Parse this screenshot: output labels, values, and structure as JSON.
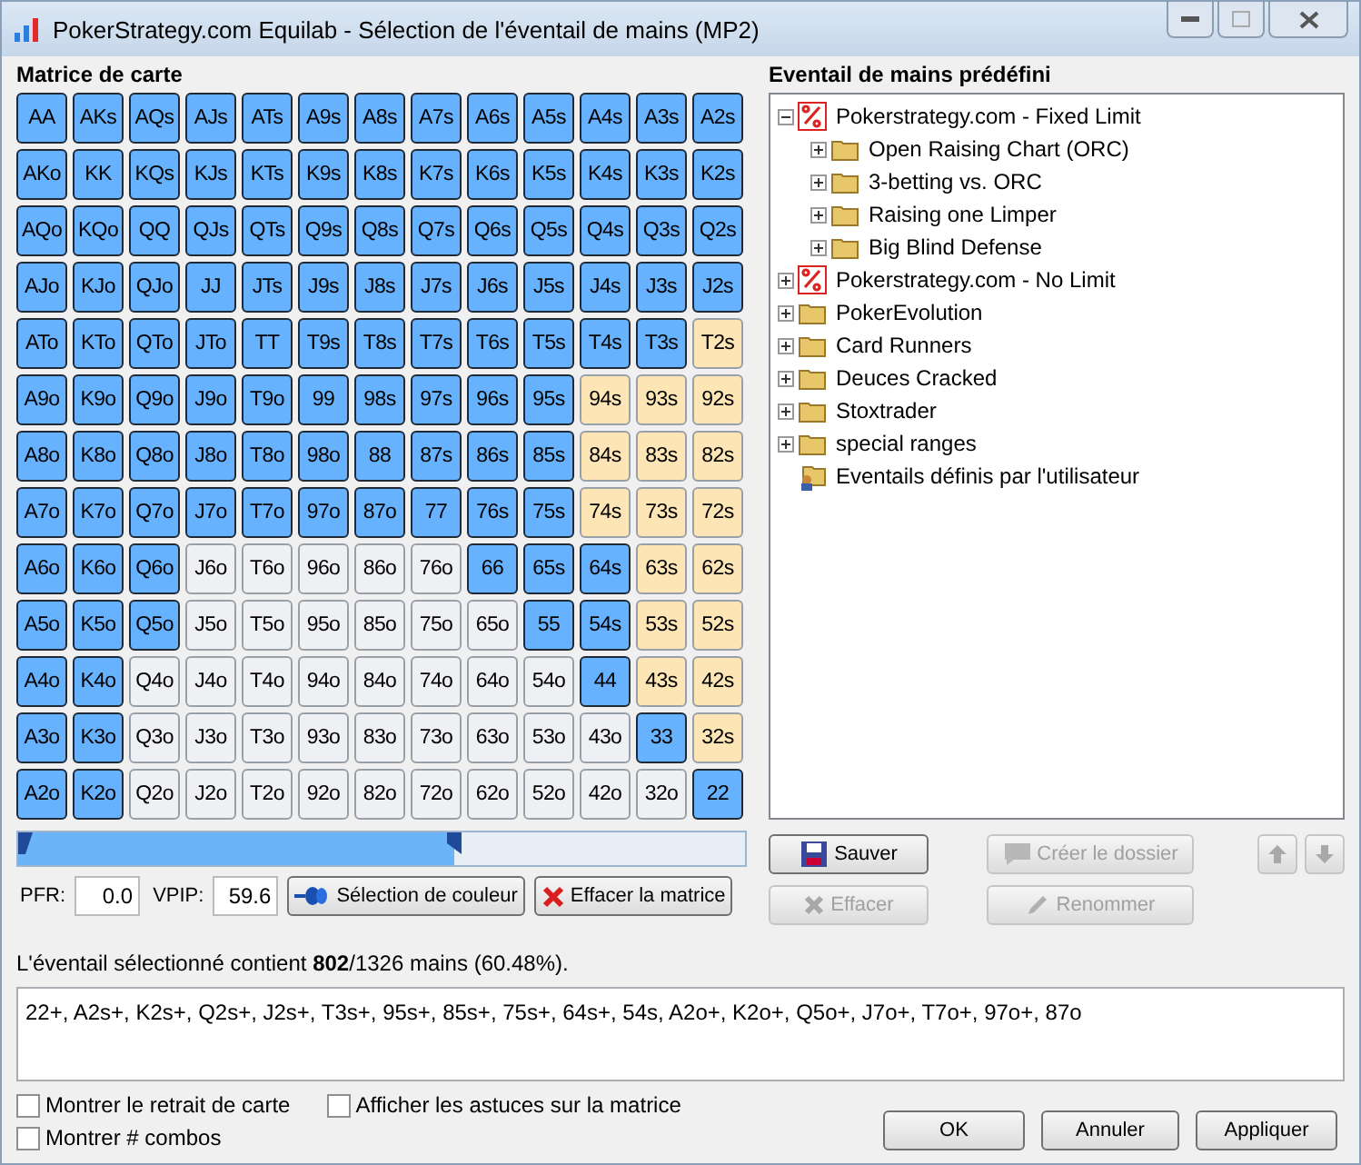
{
  "window": {
    "title": "PokerStrategy.com Equilab - Sélection de l'éventail de mains (MP2)"
  },
  "matrix": {
    "title": "Matrice de carte",
    "rows": [
      [
        {
          "label": "AA",
          "kind": "pair",
          "selected": true
        },
        {
          "label": "AKs",
          "kind": "suited",
          "selected": true
        },
        {
          "label": "AQs",
          "kind": "suited",
          "selected": true
        },
        {
          "label": "AJs",
          "kind": "suited",
          "selected": true
        },
        {
          "label": "ATs",
          "kind": "suited",
          "selected": true
        },
        {
          "label": "A9s",
          "kind": "suited",
          "selected": true
        },
        {
          "label": "A8s",
          "kind": "suited",
          "selected": true
        },
        {
          "label": "A7s",
          "kind": "suited",
          "selected": true
        },
        {
          "label": "A6s",
          "kind": "suited",
          "selected": true
        },
        {
          "label": "A5s",
          "kind": "suited",
          "selected": true
        },
        {
          "label": "A4s",
          "kind": "suited",
          "selected": true
        },
        {
          "label": "A3s",
          "kind": "suited",
          "selected": true
        },
        {
          "label": "A2s",
          "kind": "suited",
          "selected": true
        }
      ],
      [
        {
          "label": "AKo",
          "kind": "offsuit",
          "selected": true
        },
        {
          "label": "KK",
          "kind": "pair",
          "selected": true
        },
        {
          "label": "KQs",
          "kind": "suited",
          "selected": true
        },
        {
          "label": "KJs",
          "kind": "suited",
          "selected": true
        },
        {
          "label": "KTs",
          "kind": "suited",
          "selected": true
        },
        {
          "label": "K9s",
          "kind": "suited",
          "selected": true
        },
        {
          "label": "K8s",
          "kind": "suited",
          "selected": true
        },
        {
          "label": "K7s",
          "kind": "suited",
          "selected": true
        },
        {
          "label": "K6s",
          "kind": "suited",
          "selected": true
        },
        {
          "label": "K5s",
          "kind": "suited",
          "selected": true
        },
        {
          "label": "K4s",
          "kind": "suited",
          "selected": true
        },
        {
          "label": "K3s",
          "kind": "suited",
          "selected": true
        },
        {
          "label": "K2s",
          "kind": "suited",
          "selected": true
        }
      ],
      [
        {
          "label": "AQo",
          "kind": "offsuit",
          "selected": true
        },
        {
          "label": "KQo",
          "kind": "offsuit",
          "selected": true
        },
        {
          "label": "QQ",
          "kind": "pair",
          "selected": true
        },
        {
          "label": "QJs",
          "kind": "suited",
          "selected": true
        },
        {
          "label": "QTs",
          "kind": "suited",
          "selected": true
        },
        {
          "label": "Q9s",
          "kind": "suited",
          "selected": true
        },
        {
          "label": "Q8s",
          "kind": "suited",
          "selected": true
        },
        {
          "label": "Q7s",
          "kind": "suited",
          "selected": true
        },
        {
          "label": "Q6s",
          "kind": "suited",
          "selected": true
        },
        {
          "label": "Q5s",
          "kind": "suited",
          "selected": true
        },
        {
          "label": "Q4s",
          "kind": "suited",
          "selected": true
        },
        {
          "label": "Q3s",
          "kind": "suited",
          "selected": true
        },
        {
          "label": "Q2s",
          "kind": "suited",
          "selected": true
        }
      ],
      [
        {
          "label": "AJo",
          "kind": "offsuit",
          "selected": true
        },
        {
          "label": "KJo",
          "kind": "offsuit",
          "selected": true
        },
        {
          "label": "QJo",
          "kind": "offsuit",
          "selected": true
        },
        {
          "label": "JJ",
          "kind": "pair",
          "selected": true
        },
        {
          "label": "JTs",
          "kind": "suited",
          "selected": true
        },
        {
          "label": "J9s",
          "kind": "suited",
          "selected": true
        },
        {
          "label": "J8s",
          "kind": "suited",
          "selected": true
        },
        {
          "label": "J7s",
          "kind": "suited",
          "selected": true
        },
        {
          "label": "J6s",
          "kind": "suited",
          "selected": true
        },
        {
          "label": "J5s",
          "kind": "suited",
          "selected": true
        },
        {
          "label": "J4s",
          "kind": "suited",
          "selected": true
        },
        {
          "label": "J3s",
          "kind": "suited",
          "selected": true
        },
        {
          "label": "J2s",
          "kind": "suited",
          "selected": true
        }
      ],
      [
        {
          "label": "ATo",
          "kind": "offsuit",
          "selected": true
        },
        {
          "label": "KTo",
          "kind": "offsuit",
          "selected": true
        },
        {
          "label": "QTo",
          "kind": "offsuit",
          "selected": true
        },
        {
          "label": "JTo",
          "kind": "offsuit",
          "selected": true
        },
        {
          "label": "TT",
          "kind": "pair",
          "selected": true
        },
        {
          "label": "T9s",
          "kind": "suited",
          "selected": true
        },
        {
          "label": "T8s",
          "kind": "suited",
          "selected": true
        },
        {
          "label": "T7s",
          "kind": "suited",
          "selected": true
        },
        {
          "label": "T6s",
          "kind": "suited",
          "selected": true
        },
        {
          "label": "T5s",
          "kind": "suited",
          "selected": true
        },
        {
          "label": "T4s",
          "kind": "suited",
          "selected": true
        },
        {
          "label": "T3s",
          "kind": "suited",
          "selected": true
        },
        {
          "label": "T2s",
          "kind": "suited",
          "selected": false
        }
      ],
      [
        {
          "label": "A9o",
          "kind": "offsuit",
          "selected": true
        },
        {
          "label": "K9o",
          "kind": "offsuit",
          "selected": true
        },
        {
          "label": "Q9o",
          "kind": "offsuit",
          "selected": true
        },
        {
          "label": "J9o",
          "kind": "offsuit",
          "selected": true
        },
        {
          "label": "T9o",
          "kind": "offsuit",
          "selected": true
        },
        {
          "label": "99",
          "kind": "pair",
          "selected": true
        },
        {
          "label": "98s",
          "kind": "suited",
          "selected": true
        },
        {
          "label": "97s",
          "kind": "suited",
          "selected": true
        },
        {
          "label": "96s",
          "kind": "suited",
          "selected": true
        },
        {
          "label": "95s",
          "kind": "suited",
          "selected": true
        },
        {
          "label": "94s",
          "kind": "suited",
          "selected": false
        },
        {
          "label": "93s",
          "kind": "suited",
          "selected": false
        },
        {
          "label": "92s",
          "kind": "suited",
          "selected": false
        }
      ],
      [
        {
          "label": "A8o",
          "kind": "offsuit",
          "selected": true
        },
        {
          "label": "K8o",
          "kind": "offsuit",
          "selected": true
        },
        {
          "label": "Q8o",
          "kind": "offsuit",
          "selected": true
        },
        {
          "label": "J8o",
          "kind": "offsuit",
          "selected": true
        },
        {
          "label": "T8o",
          "kind": "offsuit",
          "selected": true
        },
        {
          "label": "98o",
          "kind": "offsuit",
          "selected": true
        },
        {
          "label": "88",
          "kind": "pair",
          "selected": true
        },
        {
          "label": "87s",
          "kind": "suited",
          "selected": true
        },
        {
          "label": "86s",
          "kind": "suited",
          "selected": true
        },
        {
          "label": "85s",
          "kind": "suited",
          "selected": true
        },
        {
          "label": "84s",
          "kind": "suited",
          "selected": false
        },
        {
          "label": "83s",
          "kind": "suited",
          "selected": false
        },
        {
          "label": "82s",
          "kind": "suited",
          "selected": false
        }
      ],
      [
        {
          "label": "A7o",
          "kind": "offsuit",
          "selected": true
        },
        {
          "label": "K7o",
          "kind": "offsuit",
          "selected": true
        },
        {
          "label": "Q7o",
          "kind": "offsuit",
          "selected": true
        },
        {
          "label": "J7o",
          "kind": "offsuit",
          "selected": true
        },
        {
          "label": "T7o",
          "kind": "offsuit",
          "selected": true
        },
        {
          "label": "97o",
          "kind": "offsuit",
          "selected": true
        },
        {
          "label": "87o",
          "kind": "offsuit",
          "selected": true
        },
        {
          "label": "77",
          "kind": "pair",
          "selected": true
        },
        {
          "label": "76s",
          "kind": "suited",
          "selected": true
        },
        {
          "label": "75s",
          "kind": "suited",
          "selected": true
        },
        {
          "label": "74s",
          "kind": "suited",
          "selected": false
        },
        {
          "label": "73s",
          "kind": "suited",
          "selected": false
        },
        {
          "label": "72s",
          "kind": "suited",
          "selected": false
        }
      ],
      [
        {
          "label": "A6o",
          "kind": "offsuit",
          "selected": true
        },
        {
          "label": "K6o",
          "kind": "offsuit",
          "selected": true
        },
        {
          "label": "Q6o",
          "kind": "offsuit",
          "selected": true
        },
        {
          "label": "J6o",
          "kind": "offsuit",
          "selected": false
        },
        {
          "label": "T6o",
          "kind": "offsuit",
          "selected": false
        },
        {
          "label": "96o",
          "kind": "offsuit",
          "selected": false
        },
        {
          "label": "86o",
          "kind": "offsuit",
          "selected": false
        },
        {
          "label": "76o",
          "kind": "offsuit",
          "selected": false
        },
        {
          "label": "66",
          "kind": "pair",
          "selected": true
        },
        {
          "label": "65s",
          "kind": "suited",
          "selected": true
        },
        {
          "label": "64s",
          "kind": "suited",
          "selected": true
        },
        {
          "label": "63s",
          "kind": "suited",
          "selected": false
        },
        {
          "label": "62s",
          "kind": "suited",
          "selected": false
        }
      ],
      [
        {
          "label": "A5o",
          "kind": "offsuit",
          "selected": true
        },
        {
          "label": "K5o",
          "kind": "offsuit",
          "selected": true
        },
        {
          "label": "Q5o",
          "kind": "offsuit",
          "selected": true
        },
        {
          "label": "J5o",
          "kind": "offsuit",
          "selected": false
        },
        {
          "label": "T5o",
          "kind": "offsuit",
          "selected": false
        },
        {
          "label": "95o",
          "kind": "offsuit",
          "selected": false
        },
        {
          "label": "85o",
          "kind": "offsuit",
          "selected": false
        },
        {
          "label": "75o",
          "kind": "offsuit",
          "selected": false
        },
        {
          "label": "65o",
          "kind": "offsuit",
          "selected": false
        },
        {
          "label": "55",
          "kind": "pair",
          "selected": true
        },
        {
          "label": "54s",
          "kind": "suited",
          "selected": true
        },
        {
          "label": "53s",
          "kind": "suited",
          "selected": false
        },
        {
          "label": "52s",
          "kind": "suited",
          "selected": false
        }
      ],
      [
        {
          "label": "A4o",
          "kind": "offsuit",
          "selected": true
        },
        {
          "label": "K4o",
          "kind": "offsuit",
          "selected": true
        },
        {
          "label": "Q4o",
          "kind": "offsuit",
          "selected": false
        },
        {
          "label": "J4o",
          "kind": "offsuit",
          "selected": false
        },
        {
          "label": "T4o",
          "kind": "offsuit",
          "selected": false
        },
        {
          "label": "94o",
          "kind": "offsuit",
          "selected": false
        },
        {
          "label": "84o",
          "kind": "offsuit",
          "selected": false
        },
        {
          "label": "74o",
          "kind": "offsuit",
          "selected": false
        },
        {
          "label": "64o",
          "kind": "offsuit",
          "selected": false
        },
        {
          "label": "54o",
          "kind": "offsuit",
          "selected": false
        },
        {
          "label": "44",
          "kind": "pair",
          "selected": true
        },
        {
          "label": "43s",
          "kind": "suited",
          "selected": false
        },
        {
          "label": "42s",
          "kind": "suited",
          "selected": false
        }
      ],
      [
        {
          "label": "A3o",
          "kind": "offsuit",
          "selected": true
        },
        {
          "label": "K3o",
          "kind": "offsuit",
          "selected": true
        },
        {
          "label": "Q3o",
          "kind": "offsuit",
          "selected": false
        },
        {
          "label": "J3o",
          "kind": "offsuit",
          "selected": false
        },
        {
          "label": "T3o",
          "kind": "offsuit",
          "selected": false
        },
        {
          "label": "93o",
          "kind": "offsuit",
          "selected": false
        },
        {
          "label": "83o",
          "kind": "offsuit",
          "selected": false
        },
        {
          "label": "73o",
          "kind": "offsuit",
          "selected": false
        },
        {
          "label": "63o",
          "kind": "offsuit",
          "selected": false
        },
        {
          "label": "53o",
          "kind": "offsuit",
          "selected": false
        },
        {
          "label": "43o",
          "kind": "offsuit",
          "selected": false
        },
        {
          "label": "33",
          "kind": "pair",
          "selected": true
        },
        {
          "label": "32s",
          "kind": "suited",
          "selected": false
        }
      ],
      [
        {
          "label": "A2o",
          "kind": "offsuit",
          "selected": true
        },
        {
          "label": "K2o",
          "kind": "offsuit",
          "selected": true
        },
        {
          "label": "Q2o",
          "kind": "offsuit",
          "selected": false
        },
        {
          "label": "J2o",
          "kind": "offsuit",
          "selected": false
        },
        {
          "label": "T2o",
          "kind": "offsuit",
          "selected": false
        },
        {
          "label": "92o",
          "kind": "offsuit",
          "selected": false
        },
        {
          "label": "82o",
          "kind": "offsuit",
          "selected": false
        },
        {
          "label": "72o",
          "kind": "offsuit",
          "selected": false
        },
        {
          "label": "62o",
          "kind": "offsuit",
          "selected": false
        },
        {
          "label": "52o",
          "kind": "offsuit",
          "selected": false
        },
        {
          "label": "42o",
          "kind": "offsuit",
          "selected": false
        },
        {
          "label": "32o",
          "kind": "offsuit",
          "selected": false
        },
        {
          "label": "22",
          "kind": "pair",
          "selected": true
        }
      ]
    ]
  },
  "range_slider": {
    "level": 0.6
  },
  "pfr": {
    "label": "PFR:",
    "value": "0.0"
  },
  "vpip": {
    "label": "VPIP:",
    "value": "59.6"
  },
  "matrix_buttons": [
    {
      "label": "Sélection de couleur",
      "kind": "color"
    },
    {
      "label": "Effacer la matrice",
      "kind": "clear"
    }
  ],
  "predefined": {
    "title": "Eventail de mains prédéfini",
    "tree": [
      {
        "label": "Pokerstrategy.com - Fixed Limit",
        "kind": "brand",
        "expanded": true,
        "children": [
          {
            "label": "Open Raising Chart (ORC)",
            "kind": "folder",
            "expanded": false
          },
          {
            "label": "3-betting vs. ORC",
            "kind": "folder",
            "expanded": false
          },
          {
            "label": "Raising one Limper",
            "kind": "folder",
            "expanded": false
          },
          {
            "label": "Big Blind Defense",
            "kind": "folder",
            "expanded": false
          }
        ]
      },
      {
        "label": "Pokerstrategy.com - No Limit",
        "kind": "brand",
        "expanded": false
      },
      {
        "label": "PokerEvolution",
        "kind": "folder",
        "expanded": false
      },
      {
        "label": "Card Runners",
        "kind": "folder",
        "expanded": false
      },
      {
        "label": "Deuces Cracked",
        "kind": "folder",
        "expanded": false
      },
      {
        "label": "Stoxtrader",
        "kind": "folder",
        "expanded": false
      },
      {
        "label": "special ranges",
        "kind": "folder",
        "expanded": false
      },
      {
        "label": "Eventails définis par l'utilisateur",
        "kind": "user"
      }
    ]
  },
  "tree_buttons": [
    {
      "label": "Sauver",
      "kind": "save",
      "disabled": false
    },
    {
      "label": "Créer le dossier",
      "kind": "folder",
      "disabled": true
    },
    {
      "label": "Effacer",
      "kind": "delete",
      "disabled": true
    },
    {
      "label": "Renommer",
      "kind": "rename",
      "disabled": true
    }
  ],
  "move_buttons": [
    {
      "kind": "up",
      "disabled": true
    },
    {
      "kind": "down",
      "disabled": true
    }
  ],
  "summary": "L'éventail sélectionné contient **802**/1326 mains (60.48%).",
  "range_text": "22+, A2s+, K2s+, Q2s+, J2s+, T3s+, 95s+, 85s+, 75s+, 64s+, 54s, A2o+, K2o+, Q5o+, J7o+, T7o+, 97o+, 87o",
  "options": [
    {
      "label": "Montrer le retrait de carte",
      "checked": false
    },
    {
      "label": "Afficher les astuces sur la matrice",
      "checked": false
    },
    {
      "label": "Montrer # combos",
      "checked": false
    }
  ],
  "dialog_buttons": [
    "OK",
    "Annuler",
    "Appliquer"
  ]
}
